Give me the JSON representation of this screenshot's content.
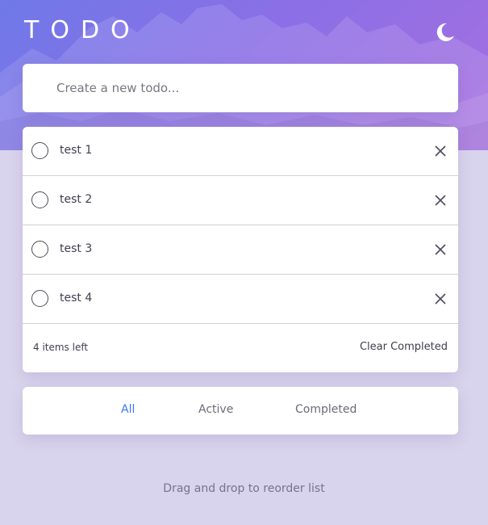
{
  "header": {
    "title": "TODO",
    "theme_icon": "moon-icon",
    "background_gradient": [
      "#6f79e8",
      "#a66fe0"
    ]
  },
  "create": {
    "placeholder": "Create a new todo..."
  },
  "todos": [
    {
      "label": "test 1",
      "completed": false
    },
    {
      "label": "test 2",
      "completed": false
    },
    {
      "label": "test 3",
      "completed": false
    },
    {
      "label": "test 4",
      "completed": false
    }
  ],
  "footer": {
    "items_left": "4 items left",
    "clear_label": "Clear Completed"
  },
  "filters": {
    "all": "All",
    "active": "Active",
    "completed": "Completed",
    "selected": "All"
  },
  "hint": "Drag and drop to reorder list",
  "colors": {
    "accent": "#3d78f5",
    "page_bg": "#d9d4ed",
    "text": "#3f3e4e"
  }
}
